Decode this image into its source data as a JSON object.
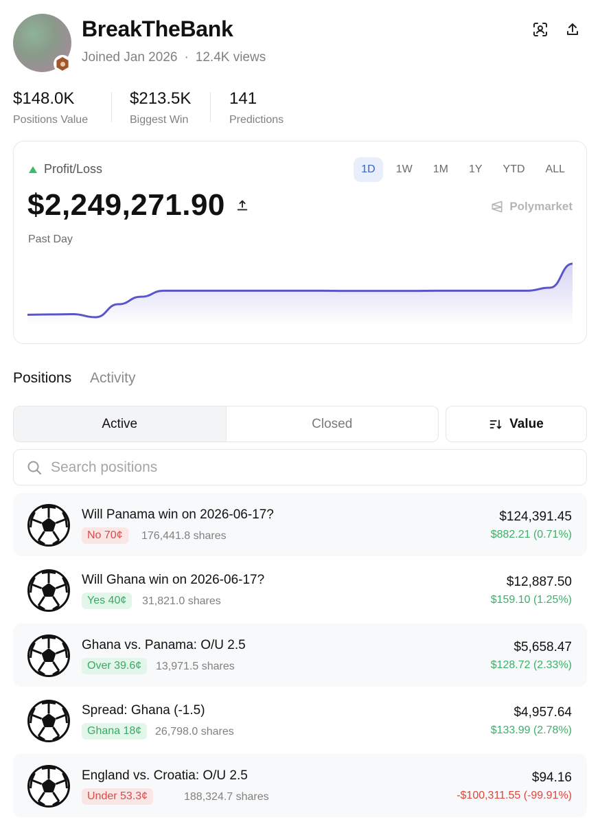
{
  "profile": {
    "username": "BreakTheBank",
    "joined": "Joined Jan 2026",
    "separator": "·",
    "views": "12.4K views",
    "avatar_icon": "avatar",
    "badge_icon": "rank-badge-icon"
  },
  "header_actions": [
    {
      "name": "scan-profile-icon"
    },
    {
      "name": "share-icon"
    }
  ],
  "stats": [
    {
      "value": "$148.0K",
      "label": "Positions Value"
    },
    {
      "value": "$213.5K",
      "label": "Biggest Win"
    },
    {
      "value": "141",
      "label": "Predictions"
    }
  ],
  "pnl": {
    "label": "Profit/Loss",
    "value": "$2,249,271.90",
    "period": "Past Day",
    "brand": "Polymarket",
    "ranges": [
      "1D",
      "1W",
      "1M",
      "1Y",
      "YTD",
      "ALL"
    ],
    "active_range": "1D",
    "accent": "#5a55c9"
  },
  "chart_data": {
    "type": "area",
    "x": [
      0,
      1,
      2,
      3,
      4,
      5,
      6,
      7,
      8,
      9,
      10,
      11,
      12,
      13,
      14,
      15,
      16,
      17,
      18,
      19,
      20,
      21,
      22,
      23,
      24
    ],
    "y": [
      0,
      0.3,
      0.6,
      -2.5,
      10.5,
      18,
      24,
      24,
      24,
      24,
      24,
      24,
      24,
      24,
      23.8,
      23.8,
      23.8,
      23.8,
      24,
      24,
      24,
      24,
      24,
      27,
      51
    ],
    "xlabel": "",
    "ylabel": "",
    "grid": false,
    "color": "#5a55c9"
  },
  "tabs": {
    "positions": "Positions",
    "activity": "Activity"
  },
  "segments": {
    "active": "Active",
    "closed": "Closed",
    "sort": "Value"
  },
  "search": {
    "placeholder": "Search positions",
    "value": ""
  },
  "positions": [
    {
      "title": "Will Panama win on 2026-06-17?",
      "outcome": "No 70¢",
      "outcome_kind": "no",
      "shares": "176,441.8 shares",
      "value": "$124,391.45",
      "change": "$882.21 (0.71%)",
      "change_kind": "pos"
    },
    {
      "title": "Will Ghana win on 2026-06-17?",
      "outcome": "Yes 40¢",
      "outcome_kind": "yes",
      "shares": "31,821.0 shares",
      "value": "$12,887.50",
      "change": "$159.10 (1.25%)",
      "change_kind": "pos"
    },
    {
      "title": "Ghana vs. Panama: O/U 2.5",
      "outcome": "Over 39.6¢",
      "outcome_kind": "yes",
      "shares": "13,971.5 shares",
      "value": "$5,658.47",
      "change": "$128.72 (2.33%)",
      "change_kind": "pos"
    },
    {
      "title": "Spread: Ghana (-1.5)",
      "outcome": "Ghana 18¢",
      "outcome_kind": "yes",
      "shares": "26,798.0 shares",
      "value": "$4,957.64",
      "change": "$133.99 (2.78%)",
      "change_kind": "pos"
    },
    {
      "title": "England vs. Croatia: O/U 2.5",
      "outcome": "Under 53.3¢",
      "outcome_kind": "no",
      "shares": "188,324.7 shares",
      "value": "$94.16",
      "change": "-$100,311.55 (-99.91%)",
      "change_kind": "neg"
    }
  ]
}
